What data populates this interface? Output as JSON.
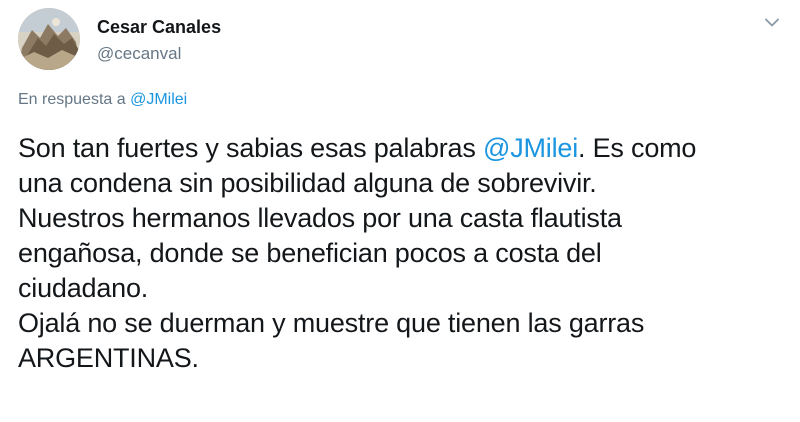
{
  "colors": {
    "text": "#14171a",
    "secondary": "#657786",
    "link": "#1b95e0",
    "background": "#ffffff"
  },
  "user": {
    "display_name": "Cesar Canales",
    "handle": "@cecanval",
    "avatar_icon": "profile-photo"
  },
  "menu_icon": "chevron-down-icon",
  "reply_context": {
    "prefix": "En respuesta a ",
    "mention": "@JMilei"
  },
  "tweet": {
    "line1_before": "Son tan fuertes y sabias esas palabras ",
    "line1_mention": "@JMilei",
    "line1_after": ". Es como",
    "line2": "una condena sin posibilidad alguna de sobrevivir.",
    "line3": "Nuestros hermanos llevados por una casta flautista",
    "line4": "engañosa, donde se benefician pocos a costa del",
    "line5": "ciudadano.",
    "line6": "Ojalá no se duerman y muestre que tienen las garras",
    "line7": "ARGENTINAS."
  }
}
